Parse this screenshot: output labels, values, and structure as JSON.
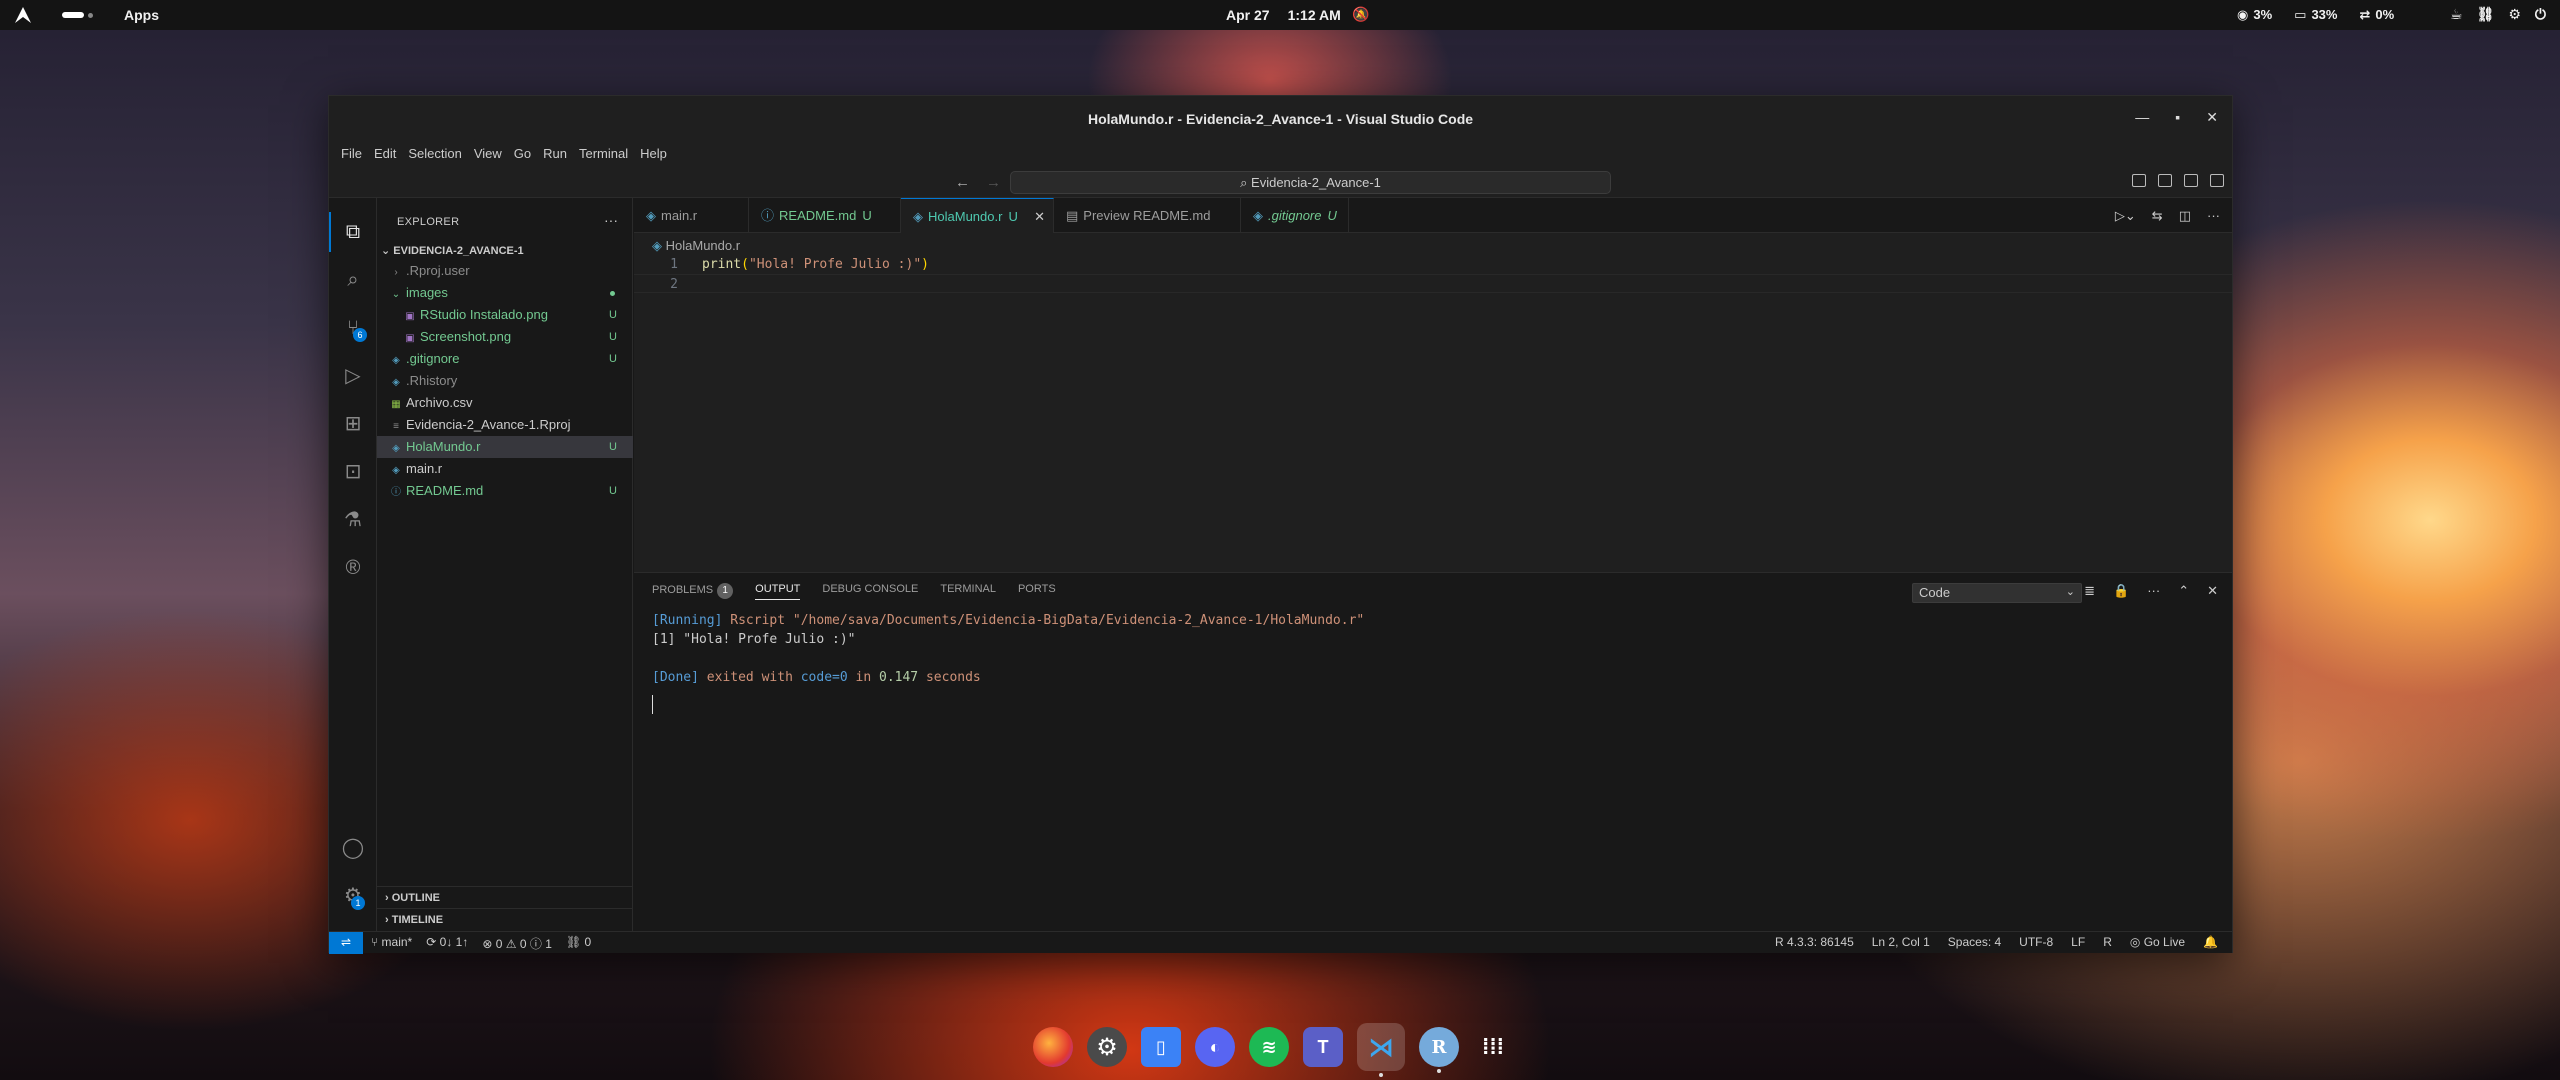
{
  "topbar": {
    "apps": "Apps",
    "date": "Apr 27",
    "time": "1:12 AM",
    "cpu": "3%",
    "memory": "33%",
    "swap": "0%"
  },
  "window": {
    "title": "HolaMundo.r - Evidencia-2_Avance-1 - Visual Studio Code",
    "menu": [
      "File",
      "Edit",
      "Selection",
      "View",
      "Go",
      "Run",
      "Terminal",
      "Help"
    ],
    "search": "Evidencia-2_Avance-1"
  },
  "sidebar": {
    "header": "EXPLORER",
    "root": "EVIDENCIA-2_AVANCE-1",
    "items": [
      {
        "label": ".Rproj.user",
        "status": ""
      },
      {
        "label": "images",
        "status": ""
      },
      {
        "label": "RStudio Instalado.png",
        "status": "U"
      },
      {
        "label": "Screenshot.png",
        "status": "U"
      },
      {
        "label": ".gitignore",
        "status": "U"
      },
      {
        "label": ".Rhistory",
        "status": ""
      },
      {
        "label": "Archivo.csv",
        "status": ""
      },
      {
        "label": "Evidencia-2_Avance-1.Rproj",
        "status": ""
      },
      {
        "label": "HolaMundo.r",
        "status": "U"
      },
      {
        "label": "main.r",
        "status": ""
      },
      {
        "label": "README.md",
        "status": "U"
      }
    ],
    "outline": "OUTLINE",
    "timeline": "TIMELINE",
    "scm_badge": "6",
    "settings_badge": "1"
  },
  "editor": {
    "tabs": [
      {
        "label": "main.r",
        "mod": ""
      },
      {
        "label": "README.md",
        "mod": "U"
      },
      {
        "label": "HolaMundo.r",
        "mod": "U"
      },
      {
        "label": "Preview README.md",
        "mod": ""
      },
      {
        "label": ".gitignore",
        "mod": "U"
      }
    ],
    "breadcrumb": "HolaMundo.r",
    "line1_num": "1",
    "line2_num": "2",
    "line1_fn": "print",
    "line1_open": "(",
    "line1_str": "\"Hola! Profe Julio :)\"",
    "line1_close": ")"
  },
  "panel": {
    "tabs": [
      "PROBLEMS",
      "OUTPUT",
      "DEBUG CONSOLE",
      "TERMINAL",
      "PORTS"
    ],
    "problems_count": "1",
    "channel": "Code",
    "out_running": "[Running]",
    "out_cmd": "Rscript \"/home/sava/Documents/Evidencia-BigData/Evidencia-2_Avance-1/HolaMundo.r\"",
    "out_result": "[1] \"Hola! Profe Julio :)\"",
    "out_done": "[Done]",
    "out_exit1": "exited with",
    "out_code": "code=0",
    "out_in": "in",
    "out_secs": "0.147",
    "out_seconds": "seconds"
  },
  "status": {
    "branch": "main*",
    "sync": "0↓ 1↑",
    "errors": "0",
    "warnings": "0",
    "info": "1",
    "ports": "0",
    "r_version": "R 4.3.3: 86145",
    "position": "Ln 2, Col 1",
    "spaces": "Spaces: 4",
    "encoding": "UTF-8",
    "eol": "LF",
    "language": "R",
    "golive": "Go Live"
  },
  "dock": {
    "r_label": "R"
  }
}
